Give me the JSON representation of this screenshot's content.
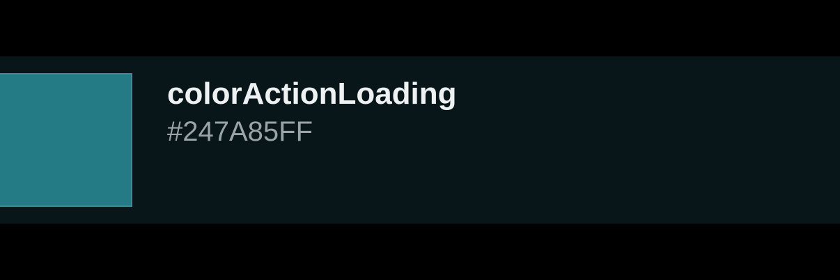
{
  "token": {
    "name": "colorActionLoading",
    "value": "#247A85FF",
    "swatch_color": "#247A85"
  },
  "colors": {
    "background": "#000000",
    "row_background": "#08161A",
    "name_text": "#EEF1F2",
    "value_text": "#9AA3A6"
  }
}
